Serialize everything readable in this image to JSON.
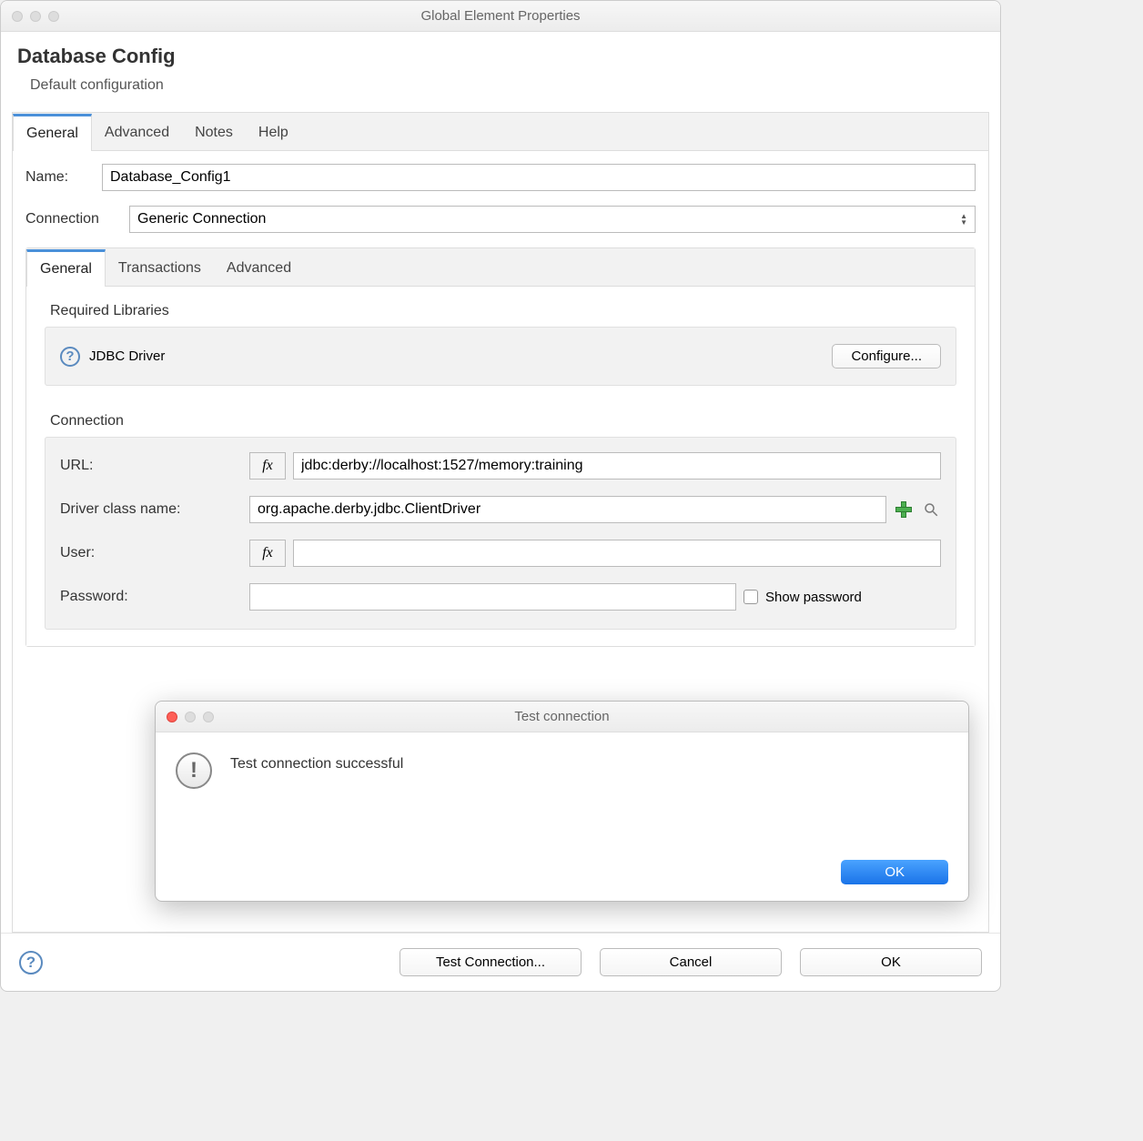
{
  "window": {
    "title": "Global Element Properties"
  },
  "header": {
    "title": "Database Config",
    "subtitle": "Default configuration"
  },
  "outer_tabs": [
    "General",
    "Advanced",
    "Notes",
    "Help"
  ],
  "form": {
    "name_label": "Name:",
    "name_value": "Database_Config1",
    "connection_label": "Connection",
    "connection_value": "Generic Connection"
  },
  "inner_tabs": [
    "General",
    "Transactions",
    "Advanced"
  ],
  "libraries": {
    "section_title": "Required Libraries",
    "driver_label": "JDBC Driver",
    "configure_button": "Configure..."
  },
  "connection": {
    "section_title": "Connection",
    "url_label": "URL:",
    "url_value": "jdbc:derby://localhost:1527/memory:training",
    "driver_label": "Driver class name:",
    "driver_value": "org.apache.derby.jdbc.ClientDriver",
    "user_label": "User:",
    "user_value": "",
    "password_label": "Password:",
    "password_value": "",
    "show_password_label": "Show password",
    "fx_label": "fx"
  },
  "bottom": {
    "test_connection": "Test Connection...",
    "cancel": "Cancel",
    "ok": "OK"
  },
  "modal": {
    "title": "Test connection",
    "message": "Test connection successful",
    "ok": "OK"
  }
}
